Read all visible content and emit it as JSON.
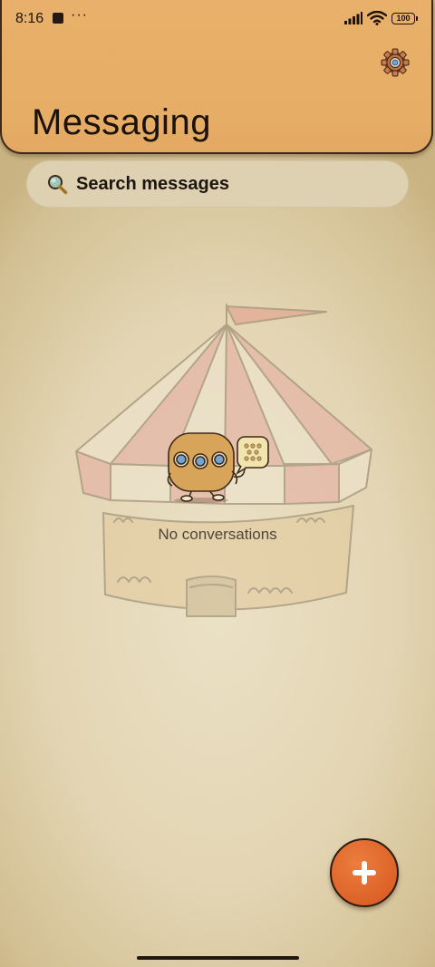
{
  "status_bar": {
    "time": "8:16",
    "overflow_dots": "···",
    "battery_level": "100"
  },
  "header": {
    "title": "Messaging",
    "settings_icon": "gear-icon"
  },
  "search": {
    "placeholder": "Search messages",
    "icon": "search-icon"
  },
  "empty_state": {
    "message": "No conversations",
    "illustration": "circus-tent-with-robot"
  },
  "fab": {
    "icon": "plus-icon",
    "action": "new-conversation"
  },
  "colors": {
    "header_bg": "#e6ad66",
    "page_bg": "#e3d5b3",
    "fab_bg": "#dd6227",
    "text_primary": "#1a120b"
  }
}
